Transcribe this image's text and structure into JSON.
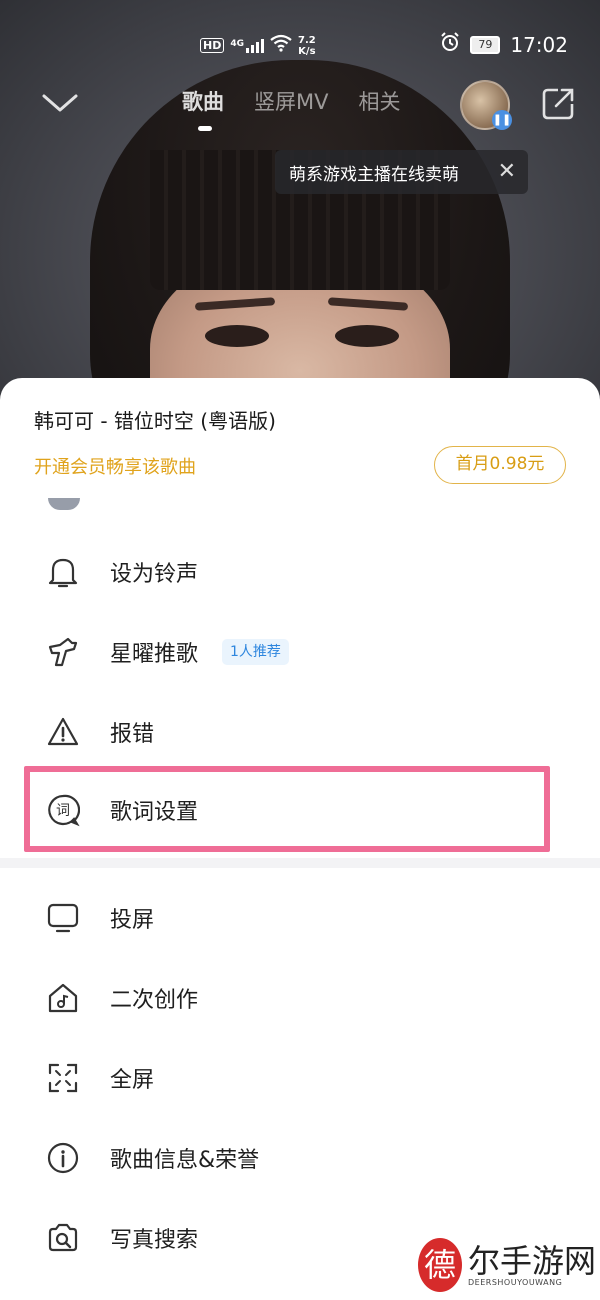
{
  "status_bar": {
    "network_label": "HD",
    "signal_label": "4G",
    "speed_value": "7.2",
    "speed_unit": "K/s",
    "battery": "79",
    "time": "17:02"
  },
  "nav": {
    "tabs": [
      {
        "label": "歌曲",
        "active": true
      },
      {
        "label": "竖屏MV",
        "active": false
      },
      {
        "label": "相关",
        "active": false
      }
    ]
  },
  "tooltip": {
    "text": "萌系游戏主播在线卖萌"
  },
  "sheet": {
    "song_title": "韩可可 - 错位时空 (粤语版)",
    "vip_promo": "开通会员畅享该歌曲",
    "price_button": "首月0.98元",
    "menu_items": [
      {
        "label": "设为铃声",
        "icon": "bell-icon"
      },
      {
        "label": "星曜推歌",
        "icon": "star-recommend-icon",
        "badge": "1人推荐"
      },
      {
        "label": "报错",
        "icon": "warning-icon"
      },
      {
        "label": "歌词设置",
        "icon": "lyrics-icon",
        "highlighted": true
      },
      {
        "label": "投屏",
        "icon": "cast-screen-icon"
      },
      {
        "label": "二次创作",
        "icon": "home-music-icon"
      },
      {
        "label": "全屏",
        "icon": "fullscreen-icon"
      },
      {
        "label": "歌曲信息&荣誉",
        "icon": "info-icon"
      },
      {
        "label": "写真搜索",
        "icon": "camera-search-icon"
      }
    ]
  },
  "watermark": {
    "seal_char": "德",
    "text": "尔手游网",
    "sub": "DEERSHOUYOUWANG"
  },
  "colors": {
    "accent_gold": "#e0a31c",
    "highlight_pink": "#ef6d96",
    "badge_blue": "#2e86de"
  }
}
